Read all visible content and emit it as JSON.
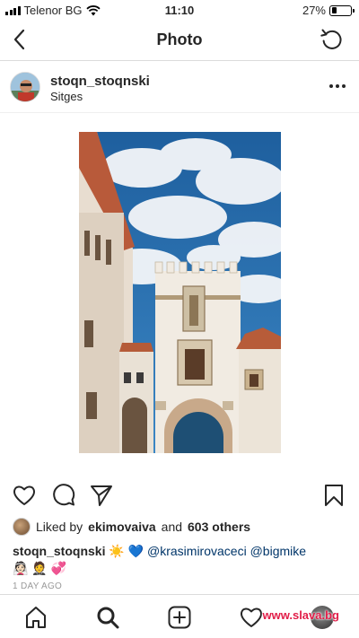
{
  "status_bar": {
    "carrier": "Telenor BG",
    "time": "11:10",
    "battery": "27%",
    "battery_level": 0.27
  },
  "nav": {
    "title": "Photo",
    "back_icon": "chevron-left-icon",
    "refresh_icon": "refresh-icon"
  },
  "post": {
    "username": "stoqn_stoqnski",
    "location": "Sitges",
    "more_icon": "more-icon",
    "image_alt": "Sitges building under blue cloudy sky"
  },
  "likes": {
    "prefix": "Liked by",
    "liker": "ekimovaiva",
    "conjunction": "and",
    "others": "603 others"
  },
  "caption": {
    "username": "stoqn_stoqnski",
    "emojis_1": "☀️ 💙",
    "mentions": "@krasimirovaceci @bigmike",
    "emojis_2": "👰🏻 🤵 💞"
  },
  "timestamp": "1 DAY AGO",
  "watermark": "www.slava.bg"
}
